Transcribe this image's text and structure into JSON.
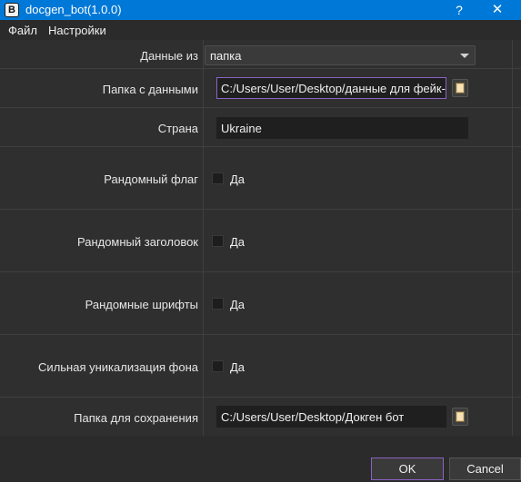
{
  "window": {
    "title": "docgen_bot(1.0.0)",
    "icon_letter": "B",
    "help_glyph": "?",
    "close_glyph": "✕"
  },
  "menu": {
    "file": "Файл",
    "settings": "Настройки"
  },
  "form": {
    "data_source": {
      "label": "Данные из",
      "value": "папка"
    },
    "data_folder": {
      "label": "Папка с данными",
      "value": "C:/Users/User/Desktop/данные для фейк-п"
    },
    "country": {
      "label": "Страна",
      "value": "Ukraine"
    },
    "random_flag": {
      "label": "Рандомный флаг",
      "checkbox_label": "Да"
    },
    "random_header": {
      "label": "Рандомный заголовок",
      "checkbox_label": "Да"
    },
    "random_fonts": {
      "label": "Рандомные шрифты",
      "checkbox_label": "Да"
    },
    "strong_bg_unique": {
      "label": "Сильная уникализация фона",
      "checkbox_label": "Да"
    },
    "save_folder": {
      "label": "Папка для сохранения",
      "value": "C:/Users/User/Desktop/Докген бот"
    }
  },
  "footer": {
    "ok": "OK",
    "cancel": "Cancel"
  },
  "colors": {
    "titlebar": "#0078d7",
    "background": "#2b2b2b",
    "focus_border": "#8a63c4"
  }
}
